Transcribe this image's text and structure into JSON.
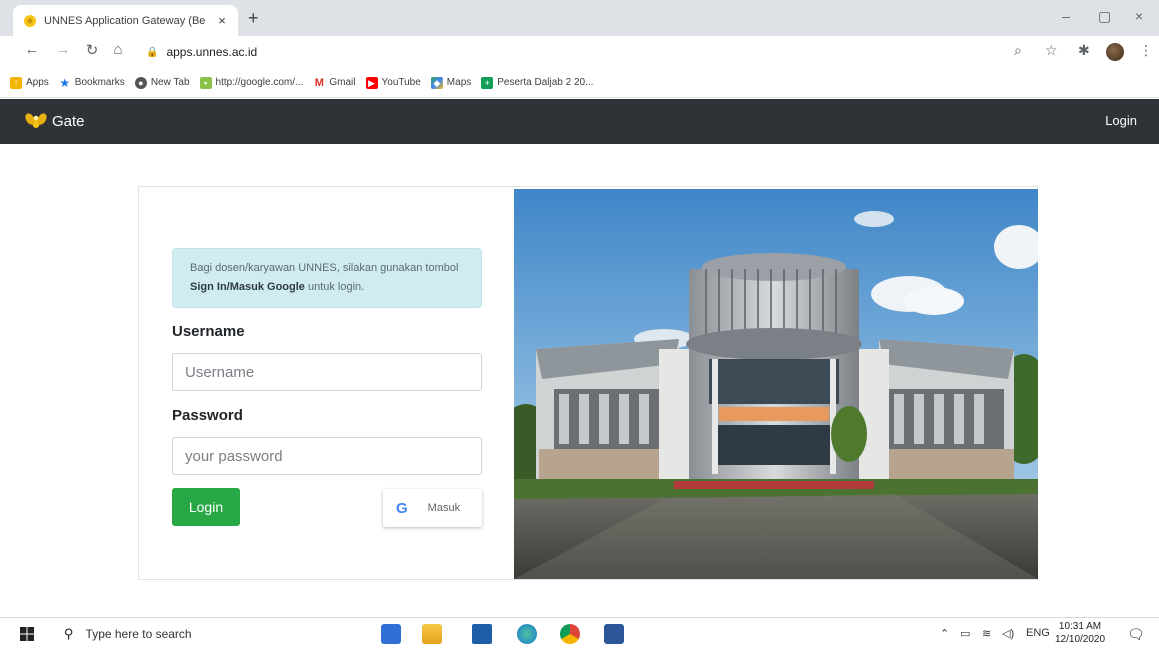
{
  "browser": {
    "tab_title": "UNNES Application Gateway (Be",
    "tab_close": "×",
    "new_tab": "+",
    "url": "apps.unnes.ac.id",
    "window_controls": {
      "minimize": "–",
      "restore": "▢",
      "close": "×"
    },
    "bookmarks": [
      {
        "label": "Apps",
        "icon": "apps-grid-icon",
        "color": "#f4b400"
      },
      {
        "label": "Bookmarks",
        "icon": "star-icon",
        "color": "#1a73e8"
      },
      {
        "label": "New Tab",
        "icon": "chrome-icon",
        "color": "#555555"
      },
      {
        "label": "http://google.com/...",
        "icon": "web-icon",
        "color": "#8bc34a"
      },
      {
        "label": "Gmail",
        "icon": "gmail-icon",
        "color": "#d93025"
      },
      {
        "label": "YouTube",
        "icon": "youtube-icon",
        "color": "#ff0000"
      },
      {
        "label": "Maps",
        "icon": "maps-icon",
        "color": "#34a853"
      },
      {
        "label": "Peserta Daljab 2 20...",
        "icon": "sheets-icon",
        "color": "#0f9d58"
      }
    ]
  },
  "navbar": {
    "brand": "Gate",
    "login_link": "Login",
    "bg": "#2f3337"
  },
  "login": {
    "info_text_1": "Bagi dosen/karyawan UNNES, silakan gunakan tombol ",
    "info_bold": "Sign In/Masuk Google",
    "info_text_2": " untuk login.",
    "username_label": "Username",
    "username_placeholder": "Username",
    "password_label": "Password",
    "password_placeholder": "your password",
    "login_button": "Login",
    "google_glyph": "G",
    "google_button": "Masuk",
    "login_button_color": "#28a745",
    "info_bg": "#d1ecf1"
  },
  "taskbar": {
    "search_placeholder": "Type here to search",
    "apps": [
      "azure-icon",
      "file-explorer-icon",
      "mail-icon",
      "edge-icon",
      "chrome-icon",
      "word-icon"
    ],
    "language": "ENG",
    "time": "10:31 AM",
    "date": "12/10/2020"
  }
}
